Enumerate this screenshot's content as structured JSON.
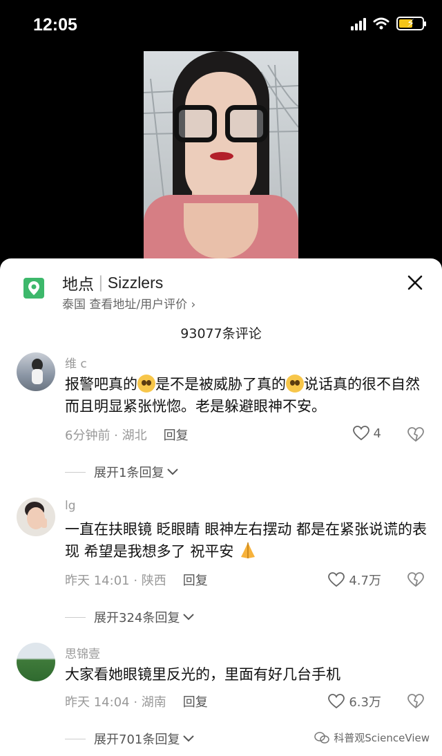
{
  "status_bar": {
    "time": "12:05"
  },
  "location": {
    "label": "地点",
    "name": "Sizzlers",
    "subtitle": "泰国 查看地址/用户评价 ›"
  },
  "comment_count": "93077条评论",
  "comments": [
    {
      "user": "维 c",
      "text_parts": [
        "报警吧真的",
        "是不是被威胁了真的",
        "说话真的很不自然而且明显紧张恍惚。老是躲避眼神不安。"
      ],
      "time_location": "6分钟前 · 湖北",
      "reply_label": "回复",
      "likes": "4",
      "expand_label": "展开1条回复"
    },
    {
      "user": "lg",
      "text": "一直在扶眼镜 眨眼睛 眼神左右摆动 都是在紧张说谎的表现 希望是我想多了 祝平安",
      "time_location": "昨天 14:01 · 陕西",
      "reply_label": "回复",
      "likes": "4.7万",
      "expand_label": "展开324条回复"
    },
    {
      "user": "思锦壹",
      "text": "大家看她眼镜里反光的，里面有好几台手机",
      "time_location": "昨天 14:04 · 湖南",
      "reply_label": "回复",
      "likes": "6.3万",
      "expand_label": "展开701条回复"
    }
  ],
  "watermark": "科普观ScienceView",
  "colors": {
    "location_icon": "#3db86b",
    "sheet": "#ffffff",
    "background": "#000000"
  }
}
